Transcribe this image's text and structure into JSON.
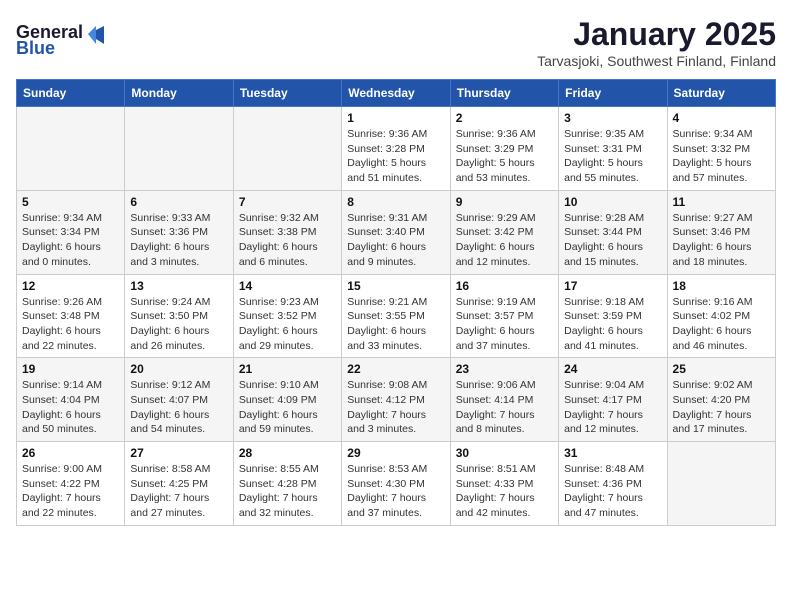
{
  "header": {
    "logo_general": "General",
    "logo_blue": "Blue",
    "title": "January 2025",
    "subtitle": "Tarvasjoki, Southwest Finland, Finland"
  },
  "days_of_week": [
    "Sunday",
    "Monday",
    "Tuesday",
    "Wednesday",
    "Thursday",
    "Friday",
    "Saturday"
  ],
  "weeks": [
    [
      {
        "day": "",
        "info": ""
      },
      {
        "day": "",
        "info": ""
      },
      {
        "day": "",
        "info": ""
      },
      {
        "day": "1",
        "info": "Sunrise: 9:36 AM\nSunset: 3:28 PM\nDaylight: 5 hours\nand 51 minutes."
      },
      {
        "day": "2",
        "info": "Sunrise: 9:36 AM\nSunset: 3:29 PM\nDaylight: 5 hours\nand 53 minutes."
      },
      {
        "day": "3",
        "info": "Sunrise: 9:35 AM\nSunset: 3:31 PM\nDaylight: 5 hours\nand 55 minutes."
      },
      {
        "day": "4",
        "info": "Sunrise: 9:34 AM\nSunset: 3:32 PM\nDaylight: 5 hours\nand 57 minutes."
      }
    ],
    [
      {
        "day": "5",
        "info": "Sunrise: 9:34 AM\nSunset: 3:34 PM\nDaylight: 6 hours\nand 0 minutes."
      },
      {
        "day": "6",
        "info": "Sunrise: 9:33 AM\nSunset: 3:36 PM\nDaylight: 6 hours\nand 3 minutes."
      },
      {
        "day": "7",
        "info": "Sunrise: 9:32 AM\nSunset: 3:38 PM\nDaylight: 6 hours\nand 6 minutes."
      },
      {
        "day": "8",
        "info": "Sunrise: 9:31 AM\nSunset: 3:40 PM\nDaylight: 6 hours\nand 9 minutes."
      },
      {
        "day": "9",
        "info": "Sunrise: 9:29 AM\nSunset: 3:42 PM\nDaylight: 6 hours\nand 12 minutes."
      },
      {
        "day": "10",
        "info": "Sunrise: 9:28 AM\nSunset: 3:44 PM\nDaylight: 6 hours\nand 15 minutes."
      },
      {
        "day": "11",
        "info": "Sunrise: 9:27 AM\nSunset: 3:46 PM\nDaylight: 6 hours\nand 18 minutes."
      }
    ],
    [
      {
        "day": "12",
        "info": "Sunrise: 9:26 AM\nSunset: 3:48 PM\nDaylight: 6 hours\nand 22 minutes."
      },
      {
        "day": "13",
        "info": "Sunrise: 9:24 AM\nSunset: 3:50 PM\nDaylight: 6 hours\nand 26 minutes."
      },
      {
        "day": "14",
        "info": "Sunrise: 9:23 AM\nSunset: 3:52 PM\nDaylight: 6 hours\nand 29 minutes."
      },
      {
        "day": "15",
        "info": "Sunrise: 9:21 AM\nSunset: 3:55 PM\nDaylight: 6 hours\nand 33 minutes."
      },
      {
        "day": "16",
        "info": "Sunrise: 9:19 AM\nSunset: 3:57 PM\nDaylight: 6 hours\nand 37 minutes."
      },
      {
        "day": "17",
        "info": "Sunrise: 9:18 AM\nSunset: 3:59 PM\nDaylight: 6 hours\nand 41 minutes."
      },
      {
        "day": "18",
        "info": "Sunrise: 9:16 AM\nSunset: 4:02 PM\nDaylight: 6 hours\nand 46 minutes."
      }
    ],
    [
      {
        "day": "19",
        "info": "Sunrise: 9:14 AM\nSunset: 4:04 PM\nDaylight: 6 hours\nand 50 minutes."
      },
      {
        "day": "20",
        "info": "Sunrise: 9:12 AM\nSunset: 4:07 PM\nDaylight: 6 hours\nand 54 minutes."
      },
      {
        "day": "21",
        "info": "Sunrise: 9:10 AM\nSunset: 4:09 PM\nDaylight: 6 hours\nand 59 minutes."
      },
      {
        "day": "22",
        "info": "Sunrise: 9:08 AM\nSunset: 4:12 PM\nDaylight: 7 hours\nand 3 minutes."
      },
      {
        "day": "23",
        "info": "Sunrise: 9:06 AM\nSunset: 4:14 PM\nDaylight: 7 hours\nand 8 minutes."
      },
      {
        "day": "24",
        "info": "Sunrise: 9:04 AM\nSunset: 4:17 PM\nDaylight: 7 hours\nand 12 minutes."
      },
      {
        "day": "25",
        "info": "Sunrise: 9:02 AM\nSunset: 4:20 PM\nDaylight: 7 hours\nand 17 minutes."
      }
    ],
    [
      {
        "day": "26",
        "info": "Sunrise: 9:00 AM\nSunset: 4:22 PM\nDaylight: 7 hours\nand 22 minutes."
      },
      {
        "day": "27",
        "info": "Sunrise: 8:58 AM\nSunset: 4:25 PM\nDaylight: 7 hours\nand 27 minutes."
      },
      {
        "day": "28",
        "info": "Sunrise: 8:55 AM\nSunset: 4:28 PM\nDaylight: 7 hours\nand 32 minutes."
      },
      {
        "day": "29",
        "info": "Sunrise: 8:53 AM\nSunset: 4:30 PM\nDaylight: 7 hours\nand 37 minutes."
      },
      {
        "day": "30",
        "info": "Sunrise: 8:51 AM\nSunset: 4:33 PM\nDaylight: 7 hours\nand 42 minutes."
      },
      {
        "day": "31",
        "info": "Sunrise: 8:48 AM\nSunset: 4:36 PM\nDaylight: 7 hours\nand 47 minutes."
      },
      {
        "day": "",
        "info": ""
      }
    ]
  ]
}
